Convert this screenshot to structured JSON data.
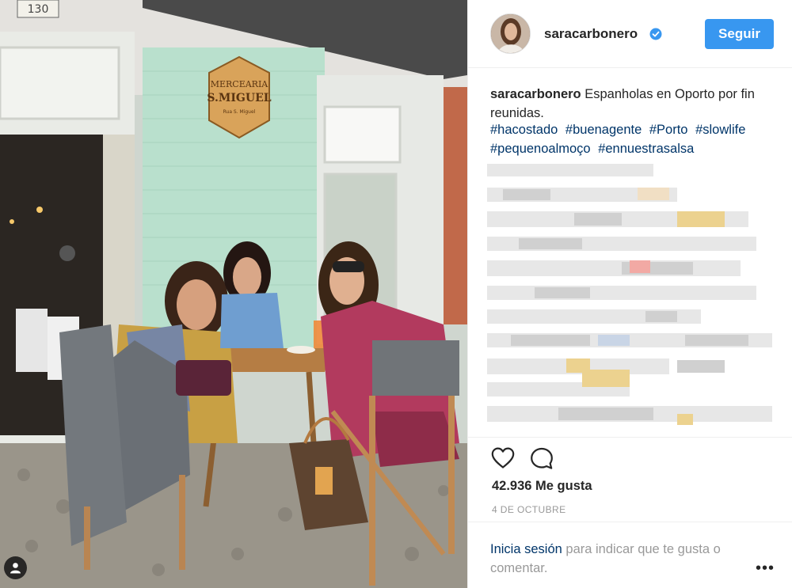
{
  "photo": {
    "shop_number": "130",
    "sign_line1": "MERCEARIA",
    "sign_line2": "S.MIGUEL",
    "sign_line3": "Rua S. Miguel",
    "tag_icon": "person-tag-icon"
  },
  "post": {
    "username": "saracarbonero",
    "verified_icon": "verified-badge-icon",
    "follow_label": "Seguir",
    "caption_user": "saracarbonero",
    "caption_text": "Espanholas en Oporto por fin reunidas.",
    "hashtags": [
      "#hacostado",
      "#buenagente",
      "#Porto",
      "#slowlife",
      "#pequenoalmoço",
      "#ennuestrasalsa"
    ],
    "like_icon": "heart-outline-icon",
    "comment_icon": "comment-bubble-icon",
    "likes": "42.936 Me gusta",
    "date": "4 DE OCTUBRE",
    "login_link": "Inicia sesión",
    "login_rest": " para indicar que te gusta o comentar.",
    "more_label": "•••"
  },
  "colors": {
    "accent": "#3897f0",
    "link": "#003569",
    "muted": "#999999"
  }
}
